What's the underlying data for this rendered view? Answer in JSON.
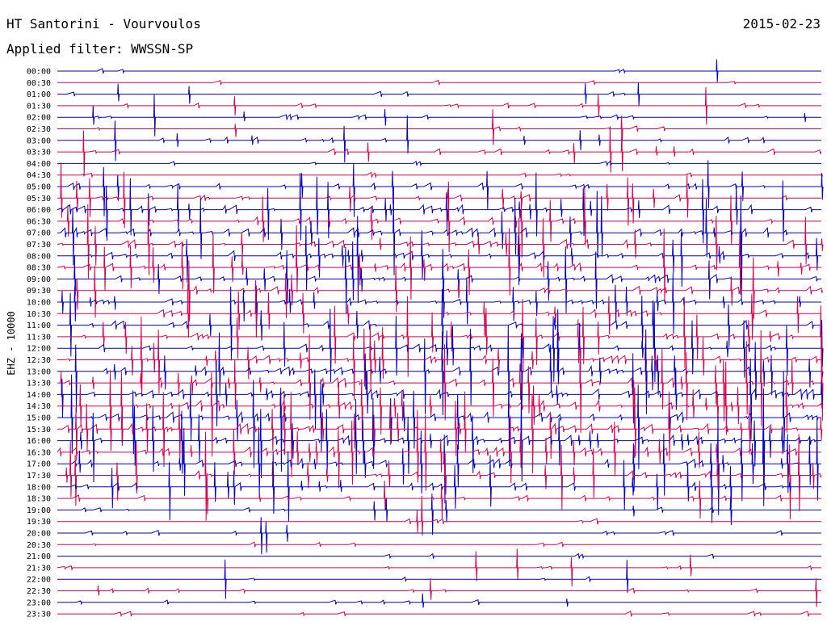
{
  "header": {
    "station": "HT Santorini - Vourvoulos",
    "filter": "Applied filter: WWSSN-SP",
    "date": "2015-02-23",
    "channel": "EHZ - 10000"
  },
  "colors": {
    "blue": "#0000cc",
    "red": "#e0004a",
    "background": "#ffffff"
  },
  "chart_data": {
    "type": "line",
    "title": "HT Santorini - Vourvoulos",
    "subtitle": "Applied filter: WWSSN-SP",
    "date": "2015-02-23",
    "ylabel": "EHZ - 10000",
    "trace_colors": [
      "#0000cc",
      "#e0004a"
    ],
    "rows": [
      "00:00",
      "00:30",
      "01:00",
      "01:30",
      "02:00",
      "02:30",
      "03:00",
      "03:30",
      "04:00",
      "04:30",
      "05:00",
      "05:30",
      "06:00",
      "06:30",
      "07:00",
      "07:30",
      "08:00",
      "08:30",
      "09:00",
      "09:30",
      "10:00",
      "10:30",
      "11:00",
      "11:30",
      "12:00",
      "12:30",
      "13:00",
      "13:30",
      "14:00",
      "14:30",
      "15:00",
      "15:30",
      "16:00",
      "16:30",
      "17:00",
      "17:30",
      "18:00",
      "18:30",
      "19:00",
      "19:30",
      "20:00",
      "20:30",
      "21:00",
      "21:30",
      "22:00",
      "22:30",
      "23:00",
      "23:30"
    ],
    "activity": [
      0.02,
      0.02,
      0.1,
      0.12,
      0.22,
      0.15,
      0.25,
      0.22,
      0.05,
      0.08,
      0.35,
      0.4,
      0.7,
      0.55,
      0.75,
      0.7,
      0.8,
      0.7,
      0.6,
      0.55,
      0.5,
      0.55,
      0.65,
      0.55,
      0.6,
      0.7,
      0.85,
      0.85,
      0.9,
      0.95,
      0.95,
      0.9,
      0.9,
      0.85,
      0.75,
      0.6,
      0.55,
      0.3,
      0.2,
      0.12,
      0.15,
      0.12,
      0.06,
      0.1,
      0.12,
      0.1,
      0.12,
      0.08
    ]
  }
}
